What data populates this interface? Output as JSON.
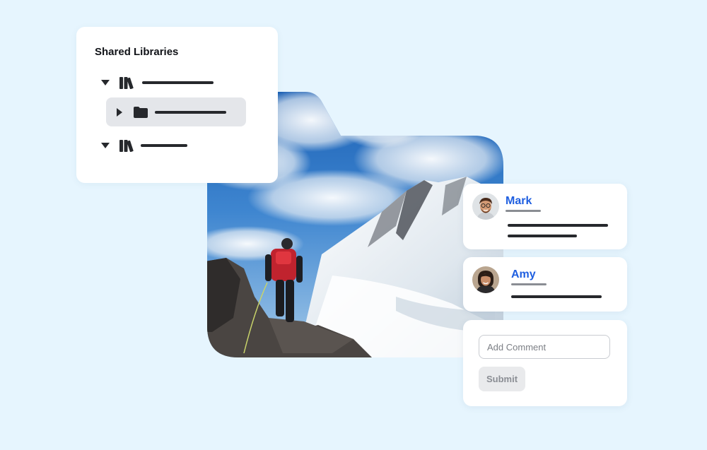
{
  "libraries": {
    "title": "Shared Libraries",
    "items": [
      {
        "type": "library",
        "expanded": true,
        "label_placeholder": true
      },
      {
        "type": "folder",
        "expanded": false,
        "selected": true,
        "label_placeholder": true
      },
      {
        "type": "library",
        "expanded": true,
        "label_placeholder": true
      }
    ]
  },
  "photo": {
    "subject": "mountaineer-on-snowy-ridge"
  },
  "comments": [
    {
      "author": "Mark",
      "avatar": "avatar-mark"
    },
    {
      "author": "Amy",
      "avatar": "avatar-amy"
    }
  ],
  "comment_form": {
    "placeholder": "Add Comment",
    "submit_label": "Submit"
  },
  "colors": {
    "background": "#e6f5fe",
    "link": "#1f5fe0",
    "text_dark": "#26282c",
    "selected_row": "#e4e6ea",
    "button_bg": "#e9eaec"
  }
}
